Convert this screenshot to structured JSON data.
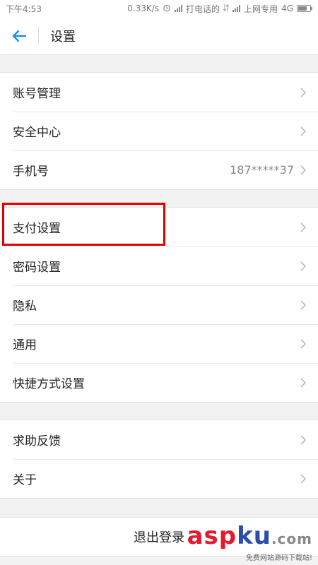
{
  "status_bar": {
    "time": "下午4:53",
    "speed": "0.33K/s",
    "sim1_label": "打电话的",
    "sim2_label": "上网专用",
    "network": "4G"
  },
  "header": {
    "title": "设置"
  },
  "groups": [
    {
      "items": [
        {
          "label": "账号管理"
        },
        {
          "label": "安全中心"
        },
        {
          "label": "手机号",
          "value": "187*****37"
        }
      ]
    },
    {
      "items": [
        {
          "label": "支付设置"
        },
        {
          "label": "密码设置"
        },
        {
          "label": "隐私"
        },
        {
          "label": "通用"
        },
        {
          "label": "快捷方式设置"
        }
      ]
    },
    {
      "items": [
        {
          "label": "求助反馈"
        },
        {
          "label": "关于"
        }
      ]
    }
  ],
  "logout_label": "退出登录",
  "watermark": {
    "part1": "asp",
    "part2": "ku",
    "part3": ".com",
    "tagline": "免费网站源码下载站!"
  },
  "colors": {
    "accent": "#1a8ee8",
    "highlight": "#e00000"
  }
}
